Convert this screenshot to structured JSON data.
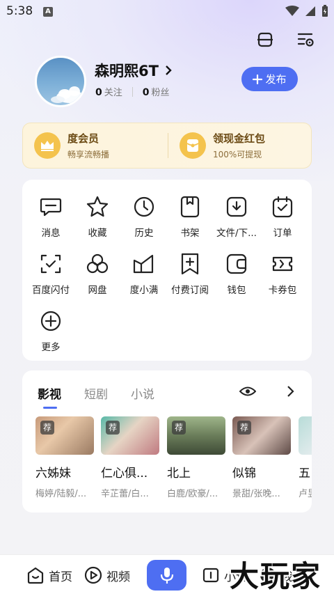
{
  "status_bar": {
    "time": "5:38",
    "notification_letter": "A"
  },
  "profile": {
    "username": "森明熙6T",
    "following_count": "0",
    "following_label": "关注",
    "fans_count": "0",
    "fans_label": "粉丝",
    "publish_label": "发布"
  },
  "vip": [
    {
      "title": "度会员",
      "subtitle": "畅享流畅播"
    },
    {
      "title": "领现金红包",
      "subtitle": "100%可提现"
    }
  ],
  "tools": [
    {
      "label": "消息",
      "icon": "message-icon"
    },
    {
      "label": "收藏",
      "icon": "star-icon"
    },
    {
      "label": "历史",
      "icon": "clock-icon"
    },
    {
      "label": "书架",
      "icon": "bookmark-icon"
    },
    {
      "label": "文件/下...",
      "icon": "download-icon"
    },
    {
      "label": "订单",
      "icon": "order-icon"
    },
    {
      "label": "百度闪付",
      "icon": "scan-pay-icon"
    },
    {
      "label": "网盘",
      "icon": "cloud-disk-icon"
    },
    {
      "label": "度小满",
      "icon": "finance-icon"
    },
    {
      "label": "付费订阅",
      "icon": "subscribe-icon"
    },
    {
      "label": "钱包",
      "icon": "wallet-icon"
    },
    {
      "label": "卡券包",
      "icon": "coupon-icon"
    },
    {
      "label": "更多",
      "icon": "plus-circle-icon"
    }
  ],
  "content": {
    "tabs": [
      "影视",
      "短剧",
      "小说"
    ],
    "active_tab": "影视",
    "recommend_tag": "荐",
    "items": [
      {
        "title": "六姊妹",
        "cast": "梅婷/陆毅/..."
      },
      {
        "title": "仁心俱...",
        "cast": "辛芷蕾/白..."
      },
      {
        "title": "北上",
        "cast": "白鹿/欧豪/..."
      },
      {
        "title": "似锦",
        "cast": "景甜/张晚..."
      },
      {
        "title": "五",
        "cast": "卢昱"
      }
    ]
  },
  "bottom_nav": {
    "home": "首页",
    "video": "视频",
    "novel": "小说",
    "mine": "我的"
  },
  "watermark": "大玩家",
  "colors": {
    "accent": "#4e6ef2",
    "vip_gold": "#f4c34d"
  }
}
